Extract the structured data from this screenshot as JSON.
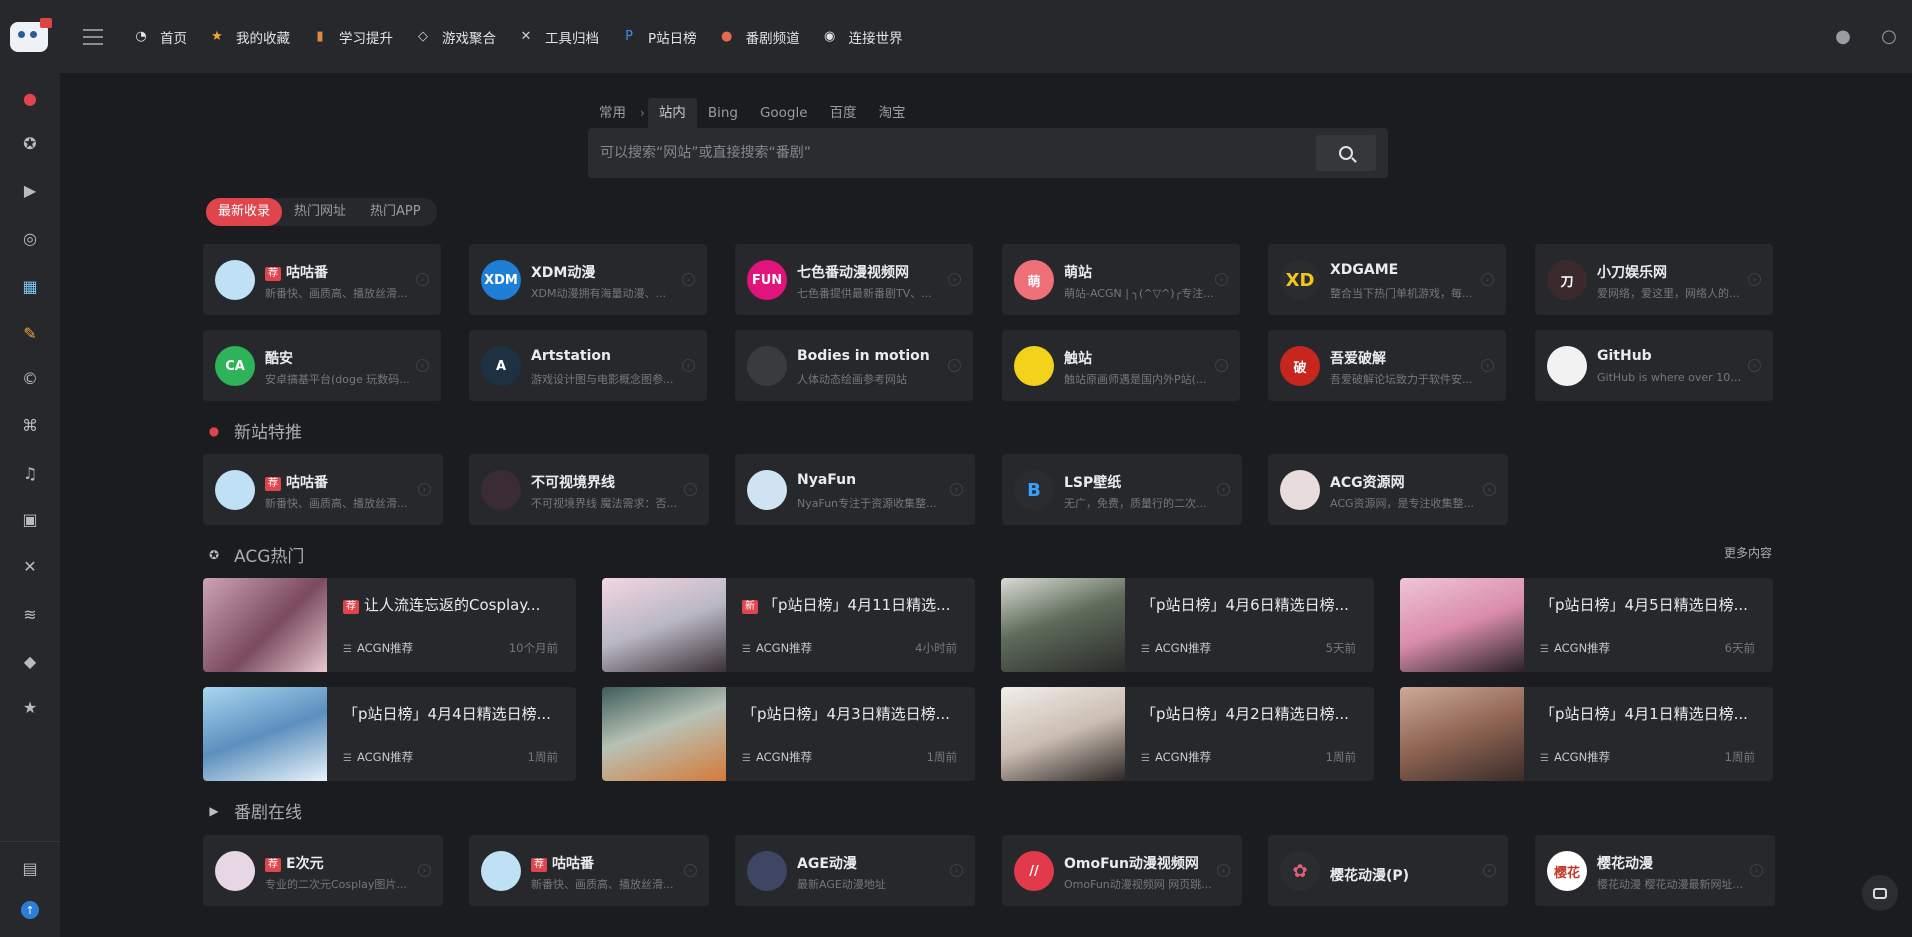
{
  "nav": {
    "items": [
      {
        "label": "首页",
        "icon": "dashboard-icon",
        "glyph": "◔",
        "color": "#e2e3e6"
      },
      {
        "label": "我的收藏",
        "icon": "bookmark-icon",
        "glyph": "★",
        "color": "#f1a92e"
      },
      {
        "label": "学习提升",
        "icon": "book-icon",
        "glyph": "▮",
        "color": "#e08a3e"
      },
      {
        "label": "游戏聚合",
        "icon": "tag-icon",
        "glyph": "◇",
        "color": "#cfd0d3"
      },
      {
        "label": "工具归档",
        "icon": "tools-icon",
        "glyph": "✕",
        "color": "#cfd0d3"
      },
      {
        "label": "P站日榜",
        "icon": "pixiv-icon",
        "glyph": "P",
        "color": "#3b8ee8"
      },
      {
        "label": "番剧频道",
        "icon": "anime-icon",
        "glyph": "●",
        "color": "#e56b50"
      },
      {
        "label": "连接世界",
        "icon": "new-icon",
        "glyph": "◉",
        "color": "#e2e3e6"
      }
    ]
  },
  "sidebar": [
    "hot-icon",
    "award-icon",
    "video-icon",
    "chrome-icon",
    "calendar-icon",
    "pen-icon",
    "copyright-icon",
    "gamepad-icon",
    "music-icon",
    "image-icon",
    "tools-icon",
    "database-icon",
    "box-icon",
    "star-icon",
    "ticket-icon",
    "upload-icon"
  ],
  "search": {
    "tabs": [
      "常用",
      "站内",
      "Bing",
      "Google",
      "百度",
      "淘宝"
    ],
    "active_tab": "站内",
    "placeholder": "可以搜索“网站”或直接搜索“番剧”"
  },
  "pills": [
    "最新收录",
    "热门网址",
    "热门APP"
  ],
  "latest": [
    {
      "title": "咕咕番",
      "badge": "荐",
      "desc": "新番快、画质高、播放丝滑...",
      "logo_text": "",
      "logo_bg": "#bfe0f5"
    },
    {
      "title": "XDM动漫",
      "badge": "",
      "desc": "XDM动漫拥有海量动漫、...",
      "logo_text": "XDM",
      "logo_bg": "#1f7fd6"
    },
    {
      "title": "七色番动漫视频网",
      "badge": "",
      "desc": "七色番提供最新番剧TV、...",
      "logo_text": "FUN",
      "logo_bg": "#e2137a"
    },
    {
      "title": "萌站",
      "badge": "",
      "desc": "萌站-ACGN | ╮(^▽^)╭专注...",
      "logo_text": "萌",
      "logo_bg": "#f0707a"
    },
    {
      "title": "XDGAME",
      "badge": "",
      "desc": "整合当下热门单机游戏，每...",
      "logo_text": "XD",
      "logo_bg": "#2b2c30"
    },
    {
      "title": "小刀娱乐网",
      "badge": "",
      "desc": "爱网络，爱这里，网络人的...",
      "logo_text": "刀",
      "logo_bg": "#3a2a2c"
    },
    {
      "title": "酷安",
      "badge": "",
      "desc": "安卓搞基平台(doge 玩数码...",
      "logo_text": "CA",
      "logo_bg": "#2fb35a"
    },
    {
      "title": "Artstation",
      "badge": "",
      "desc": "游戏设计图与电影概念图参...",
      "logo_text": "A",
      "logo_bg": "#1d3142"
    },
    {
      "title": "Bodies in motion",
      "badge": "",
      "desc": "人体动态绘画参考网站",
      "logo_text": "",
      "logo_bg": "#3a3b3f"
    },
    {
      "title": "触站",
      "badge": "",
      "desc": "触站原画师遇是国内外P站(...",
      "logo_text": "",
      "logo_bg": "#f2d21a"
    },
    {
      "title": "吾爱破解",
      "badge": "",
      "desc": "吾爱破解论坛致力于软件安...",
      "logo_text": "破",
      "logo_bg": "#c7261f"
    },
    {
      "title": "GitHub",
      "badge": "",
      "desc": "GitHub is where over 100 ...",
      "logo_text": "",
      "logo_bg": "#f2f2f2"
    }
  ],
  "new_sites": {
    "title": "新站特推",
    "items": [
      {
        "title": "咕咕番",
        "badge": "荐",
        "desc": "新番快、画质高、播放丝滑...",
        "logo_text": "",
        "logo_bg": "#bfe0f5"
      },
      {
        "title": "不可视境界线",
        "badge": "",
        "desc": "不可视境界线 魔法需求：否...",
        "logo_text": "",
        "logo_bg": "#3a2b34"
      },
      {
        "title": "NyaFun",
        "badge": "",
        "desc": "NyaFun专注于资源收集整...",
        "logo_text": "",
        "logo_bg": "#cfe3f2"
      },
      {
        "title": "LSP壁纸",
        "badge": "",
        "desc": "无广，免费，质量行的二次...",
        "logo_text": "B",
        "logo_bg": "#2b2c30"
      },
      {
        "title": "ACG资源网",
        "badge": "",
        "desc": "ACG资源网，是专注收集整...",
        "logo_text": "",
        "logo_bg": "#e8dcdc"
      }
    ]
  },
  "acg_hot": {
    "title": "ACG热门",
    "more": "更多内容",
    "items": [
      {
        "title": "让人流连忘返的Cosplay...",
        "badge": "荐",
        "cat": "ACGN推荐",
        "time": "10个月前",
        "thumb": "linear-gradient(135deg,#cda4b4,#7a4a5e 55%,#e6c9d0)"
      },
      {
        "title": "「p站日榜」4月11日精选...",
        "badge": "新",
        "cat": "ACGN推荐",
        "time": "4小时前",
        "thumb": "linear-gradient(160deg,#f2d6e2,#b9b7c4 50%,#3b3036)"
      },
      {
        "title": "「p站日榜」4月6日精选日榜...",
        "badge": "",
        "cat": "ACGN推荐",
        "time": "5天前",
        "thumb": "linear-gradient(160deg,#d9dcd4,#5e6b5a 45%,#2a2a2a)"
      },
      {
        "title": "「p站日榜」4月5日精选日榜...",
        "badge": "",
        "cat": "ACGN推荐",
        "time": "6天前",
        "thumb": "linear-gradient(160deg,#f0c4d6,#d98cab 50%,#2a2326)"
      },
      {
        "title": "「p站日榜」4月4日精选日榜...",
        "badge": "",
        "cat": "ACGN推荐",
        "time": "1周前",
        "thumb": "linear-gradient(160deg,#a9d6f0,#5c8fbe 50%,#e9f3fa)"
      },
      {
        "title": "「p站日榜」4月3日精选日榜...",
        "badge": "",
        "cat": "ACGN推荐",
        "time": "1周前",
        "thumb": "linear-gradient(160deg,#3d5c5a,#b8c2b5 45%,#d47a3a)"
      },
      {
        "title": "「p站日榜」4月2日精选日榜...",
        "badge": "",
        "cat": "ACGN推荐",
        "time": "1周前",
        "thumb": "linear-gradient(160deg,#f1efe9,#cbbdb2 50%,#2b2624)"
      },
      {
        "title": "「p站日榜」4月1日精选日榜...",
        "badge": "",
        "cat": "ACGN推荐",
        "time": "1周前",
        "thumb": "linear-gradient(160deg,#cfa99a,#8e6452 50%,#3a2c2a)"
      }
    ]
  },
  "anime": {
    "title": "番剧在线",
    "items": [
      {
        "title": "E次元",
        "badge": "荐",
        "desc": "专业的二次元Cosplay图片...",
        "logo_text": "",
        "logo_bg": "#e7d7e4"
      },
      {
        "title": "咕咕番",
        "badge": "荐",
        "desc": "新番快、画质高、播放丝滑...",
        "logo_text": "",
        "logo_bg": "#bfe0f5"
      },
      {
        "title": "AGE动漫",
        "badge": "",
        "desc": "最新AGE动漫地址",
        "logo_text": "",
        "logo_bg": "#3f4663"
      },
      {
        "title": "OmoFun动漫视频网",
        "badge": "",
        "desc": "OmoFun动漫视频网 网页跳...",
        "logo_text": "//",
        "logo_bg": "#e23a4a"
      },
      {
        "title": "樱花动漫(P)",
        "badge": "",
        "desc": "",
        "logo_text": "✿",
        "logo_bg": "#2b2c30"
      },
      {
        "title": "樱花动漫",
        "badge": "",
        "desc": "樱花动漫 樱花动漫最新网址...",
        "logo_text": "樱花",
        "logo_bg": "#ffffff"
      }
    ]
  }
}
